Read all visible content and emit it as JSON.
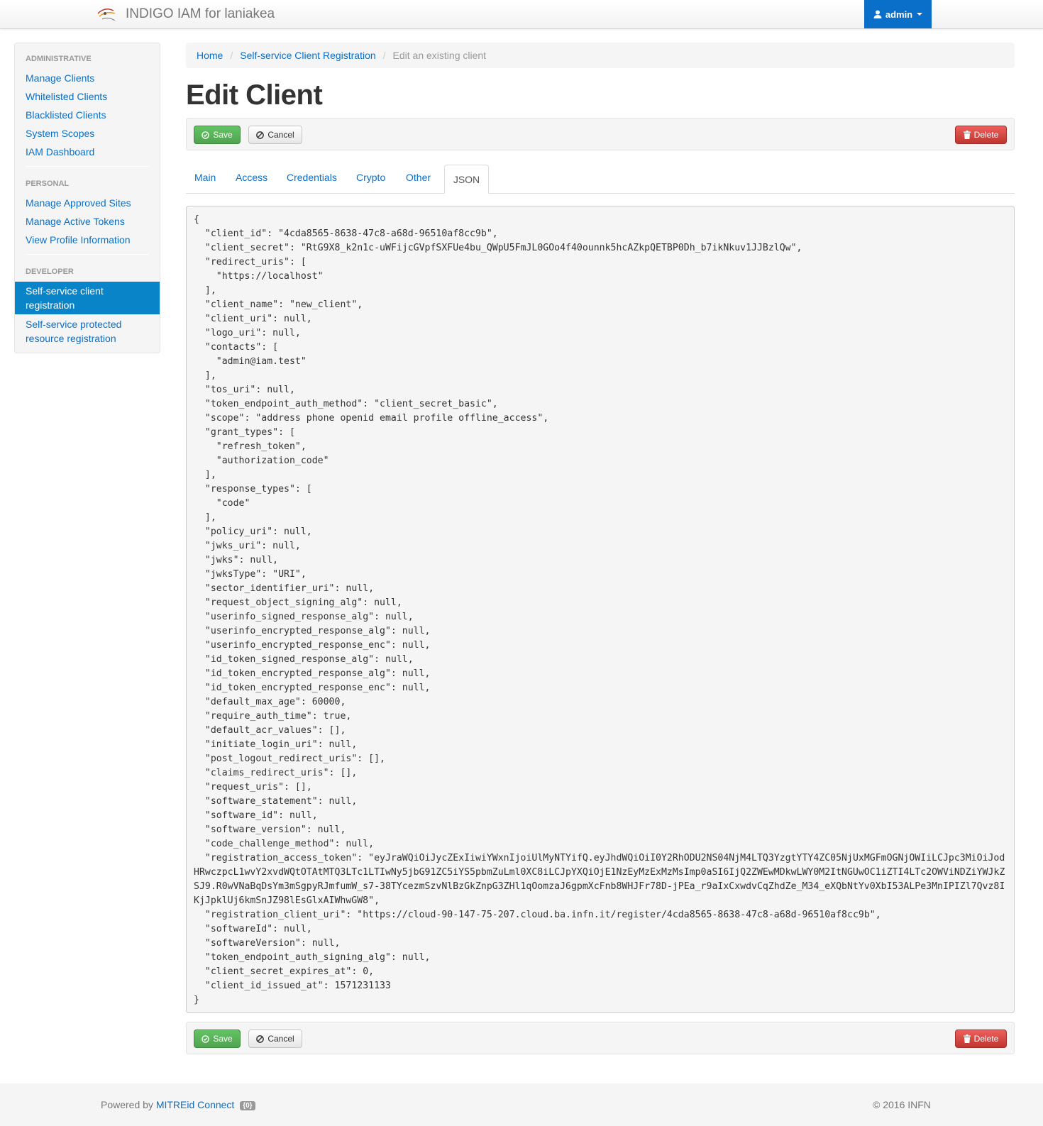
{
  "header": {
    "app_title": "INDIGO IAM for laniakea",
    "user": "admin"
  },
  "sidebar": {
    "administrative_header": "ADMINISTRATIVE",
    "administrative": [
      "Manage Clients",
      "Whitelisted Clients",
      "Blacklisted Clients",
      "System Scopes",
      "IAM Dashboard"
    ],
    "personal_header": "PERSONAL",
    "personal": [
      "Manage Approved Sites",
      "Manage Active Tokens",
      "View Profile Information"
    ],
    "developer_header": "DEVELOPER",
    "developer_active": "Self-service client registration",
    "developer_other": "Self-service protected resource registration"
  },
  "breadcrumb": [
    "Home",
    "Self-service Client Registration",
    "Edit an existing client"
  ],
  "page_title": "Edit Client",
  "buttons": {
    "save": "Save",
    "cancel": "Cancel",
    "delete": "Delete"
  },
  "tabs": [
    "Main",
    "Access",
    "Credentials",
    "Crypto",
    "Other",
    "JSON"
  ],
  "active_tab": "JSON",
  "json_text": "{\n  \"client_id\": \"4cda8565-8638-47c8-a68d-96510af8cc9b\",\n  \"client_secret\": \"RtG9X8_k2n1c-uWFijcGVpfSXFUe4bu_QWpU5FmJL0GOo4f40ounnk5hcAZkpQETBP0Dh_b7ikNkuv1JJBzlQw\",\n  \"redirect_uris\": [\n    \"https://localhost\"\n  ],\n  \"client_name\": \"new_client\",\n  \"client_uri\": null,\n  \"logo_uri\": null,\n  \"contacts\": [\n    \"admin@iam.test\"\n  ],\n  \"tos_uri\": null,\n  \"token_endpoint_auth_method\": \"client_secret_basic\",\n  \"scope\": \"address phone openid email profile offline_access\",\n  \"grant_types\": [\n    \"refresh_token\",\n    \"authorization_code\"\n  ],\n  \"response_types\": [\n    \"code\"\n  ],\n  \"policy_uri\": null,\n  \"jwks_uri\": null,\n  \"jwks\": null,\n  \"jwksType\": \"URI\",\n  \"sector_identifier_uri\": null,\n  \"request_object_signing_alg\": null,\n  \"userinfo_signed_response_alg\": null,\n  \"userinfo_encrypted_response_alg\": null,\n  \"userinfo_encrypted_response_enc\": null,\n  \"id_token_signed_response_alg\": null,\n  \"id_token_encrypted_response_alg\": null,\n  \"id_token_encrypted_response_enc\": null,\n  \"default_max_age\": 60000,\n  \"require_auth_time\": true,\n  \"default_acr_values\": [],\n  \"initiate_login_uri\": null,\n  \"post_logout_redirect_uris\": [],\n  \"claims_redirect_uris\": [],\n  \"request_uris\": [],\n  \"software_statement\": null,\n  \"software_id\": null,\n  \"software_version\": null,\n  \"code_challenge_method\": null,\n  \"registration_access_token\": \"eyJraWQiOiJycZExIiwiYWxnIjoiUlMyNTYifQ.eyJhdWQiOiI0Y2RhODU2NS04NjM4LTQ3YzgtYTY4ZC05NjUxMGFmOGNjOWIiLCJpc3MiOiJodHRwczpcL1wvY2xvdWQtOTAtMTQ3LTc1LTIwNy5jbG91ZC5iYS5pbmZuLml0XC8iLCJpYXQiOjE1NzEyMzExMzMsImp0aSI6IjQ2ZWEwMDkwLWY0M2ItNGUwOC1iZTI4LTc2OWViNDZiYWJkZSJ9.R0wVNaBqDsYm3mSgpyRJmfumW_s7-38TYcezmSzvNlBzGkZnpG3ZHl1qOomzaJ6gpmXcFnb8WHJFr78D-jPEa_r9aIxCxwdvCqZhdZe_M34_eXQbNtYv0XbI53ALPe3MnIPIZl7Qvz8IKjJpklUj6kmSnJZ98lEsGlxAIWhwGW8\",\n  \"registration_client_uri\": \"https://cloud-90-147-75-207.cloud.ba.infn.it/register/4cda8565-8638-47c8-a68d-96510af8cc9b\",\n  \"softwareId\": null,\n  \"softwareVersion\": null,\n  \"token_endpoint_auth_signing_alg\": null,\n  \"client_secret_expires_at\": 0,\n  \"client_id_issued_at\": 1571231133\n}",
  "footer": {
    "powered_prefix": "Powered by",
    "powered_link": "MITREid Connect",
    "version": "{0}",
    "copyright": "© 2016 INFN"
  },
  "colors": {
    "link": "#0a6fc8",
    "active_nav": "#0a84c8",
    "save": "#5bb75b",
    "delete": "#da4f49"
  }
}
